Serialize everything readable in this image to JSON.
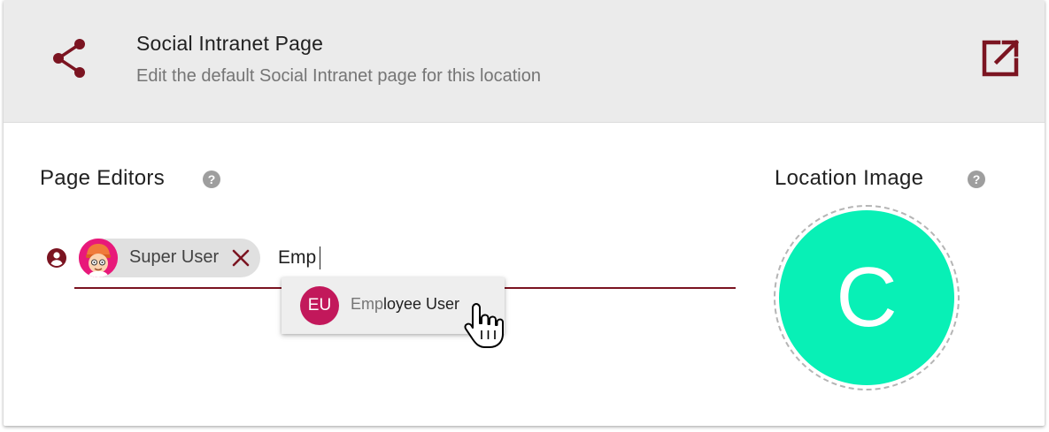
{
  "header": {
    "title": "Social Intranet Page",
    "subtitle": "Edit the default Social Intranet page for this location",
    "leading_icon": "share-icon",
    "action_icon": "open-in-new-icon"
  },
  "page_editors": {
    "title": "Page Editors",
    "help_glyph": "?",
    "field_icon": "account-circle-icon",
    "chips": [
      {
        "label": "Super User",
        "avatar": "cartoon-avatar"
      }
    ],
    "search_value": "Emp",
    "suggestions": [
      {
        "initials": "EU",
        "match": "Emp",
        "rest": "loyee User"
      }
    ]
  },
  "location_image": {
    "title": "Location Image",
    "help_glyph": "?",
    "letter": "C"
  },
  "colors": {
    "accent": "#7b1421",
    "header_bg": "#ebebeb",
    "location_circle": "#08f0b6",
    "eu_avatar": "#c2185b",
    "chip_avatar": "#e8197a"
  }
}
